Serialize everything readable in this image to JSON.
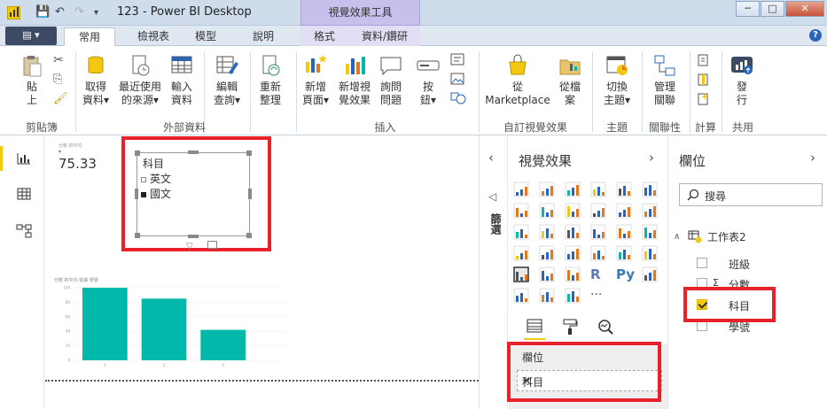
{
  "window": {
    "title": "123 - Power BI Desktop",
    "context_header": "視覺效果工具",
    "minimize": "─",
    "maximize": "□",
    "close": "✕"
  },
  "tabs": {
    "file": "▤ ▾",
    "items": [
      "常用",
      "檢視表",
      "模型",
      "說明"
    ],
    "context_items": [
      "格式",
      "資料/鑽研"
    ],
    "help": "?"
  },
  "ribbon": {
    "clipboard": {
      "paste": "貼\n上",
      "group": "剪貼簿"
    },
    "external": {
      "get_data": [
        "取得",
        "資料▾"
      ],
      "recent": [
        "最近使用",
        "的來源▾"
      ],
      "enter": [
        "輸入",
        "資料"
      ],
      "edit": [
        "編輯",
        "查詢▾"
      ],
      "refresh": [
        "重新",
        "整理"
      ],
      "group": "外部資料"
    },
    "insert": {
      "new_page": [
        "新增",
        "頁面▾"
      ],
      "new_visual": [
        "新增視",
        "覺效果"
      ],
      "ask": [
        "詢問",
        "問題"
      ],
      "buttons": [
        "按",
        "鈕▾"
      ],
      "group": "插入"
    },
    "custom": {
      "marketplace": [
        "從",
        "Marketplace"
      ],
      "file": [
        "從檔",
        "案"
      ],
      "group": "自訂視覺效果"
    },
    "themes": {
      "switch": [
        "切換",
        "主題▾"
      ],
      "group": "主題"
    },
    "relationships": {
      "manage": [
        "管理",
        "關聯"
      ],
      "group": "關聯性"
    },
    "calculations": {
      "group": "計算"
    },
    "share": {
      "publish": [
        "發",
        "行"
      ],
      "group": "共用"
    }
  },
  "canvas": {
    "card_label": "分數 的平均",
    "card_value": "75.33",
    "slicer": {
      "title": "科目",
      "items": [
        {
          "label": "英文",
          "selected": false
        },
        {
          "label": "國文",
          "selected": true
        }
      ]
    },
    "chart_title": "分數 的平均 依據 學號"
  },
  "chart_data": {
    "type": "bar",
    "title": "分數 的平均 依據 學號",
    "categories": [
      "1",
      "2",
      "3"
    ],
    "values": [
      100,
      85,
      42
    ],
    "ylim": [
      0,
      100
    ],
    "yticks": [
      0,
      20,
      40,
      60,
      80,
      100
    ],
    "color": "#01b8aa"
  },
  "viz_pane": {
    "title": "視覺效果",
    "collapse_label": "篩選",
    "wells_label": "欄位",
    "field_value": "科目",
    "more": "···"
  },
  "fields_pane": {
    "title": "欄位",
    "search_placeholder": "搜尋",
    "table": "工作表2",
    "fields": [
      {
        "label": "班級",
        "checked": false,
        "sigma": false
      },
      {
        "label": "分數",
        "checked": false,
        "sigma": true
      },
      {
        "label": "科目",
        "checked": true,
        "sigma": false
      },
      {
        "label": "學號",
        "checked": false,
        "sigma": false
      }
    ]
  },
  "colors": {
    "accent": "#f2c811",
    "highlight": "#e8212b",
    "bar": "#01b8aa"
  }
}
